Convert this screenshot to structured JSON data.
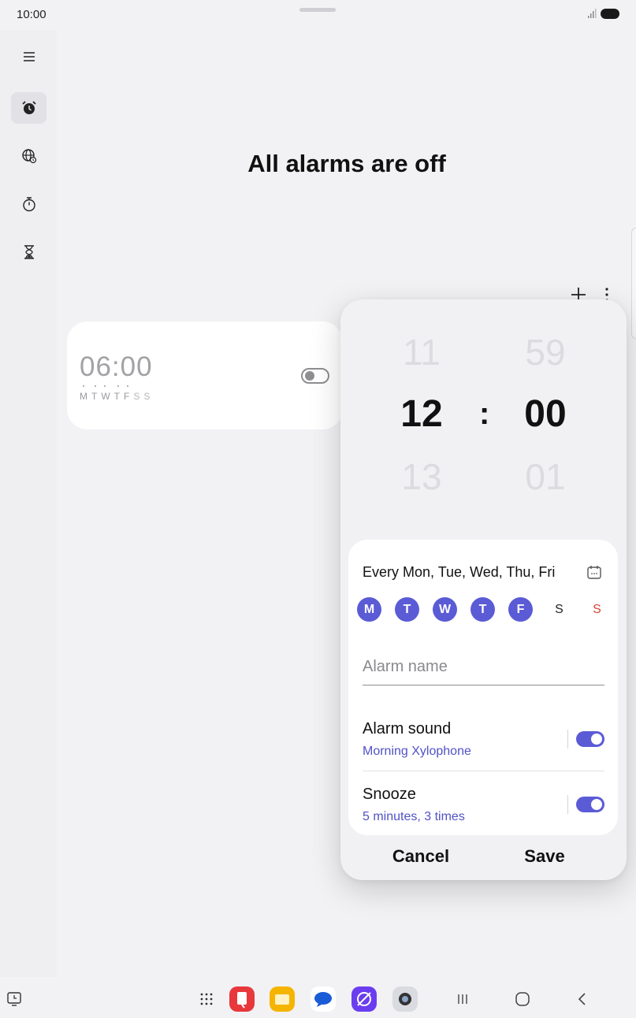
{
  "status_bar": {
    "time": "10:00"
  },
  "main": {
    "empty_title": "All alarms are off"
  },
  "alarm_card": {
    "time": "06:00",
    "days": [
      "M",
      "T",
      "W",
      "T",
      "F",
      "S",
      "S"
    ],
    "enabled": false
  },
  "editor": {
    "hour_prev": "11",
    "hour_current": "12",
    "hour_next": "13",
    "minute_prev": "59",
    "minute_current": "00",
    "minute_next": "01",
    "separator": ":",
    "repeat_summary": "Every Mon, Tue, Wed, Thu, Fri",
    "days": [
      {
        "label": "M",
        "selected": true
      },
      {
        "label": "T",
        "selected": true
      },
      {
        "label": "W",
        "selected": true
      },
      {
        "label": "T",
        "selected": true
      },
      {
        "label": "F",
        "selected": true
      },
      {
        "label": "S",
        "selected": false
      },
      {
        "label": "S",
        "selected": false
      }
    ],
    "alarm_name_placeholder": "Alarm name",
    "alarm_sound": {
      "title": "Alarm sound",
      "value": "Morning Xylophone",
      "enabled": true
    },
    "snooze": {
      "title": "Snooze",
      "value": "5 minutes, 3 times",
      "enabled": true
    },
    "cancel_label": "Cancel",
    "save_label": "Save"
  },
  "colors": {
    "accent": "#5b5bd6",
    "sunday": "#d9443a",
    "background": "#f2f2f4"
  }
}
